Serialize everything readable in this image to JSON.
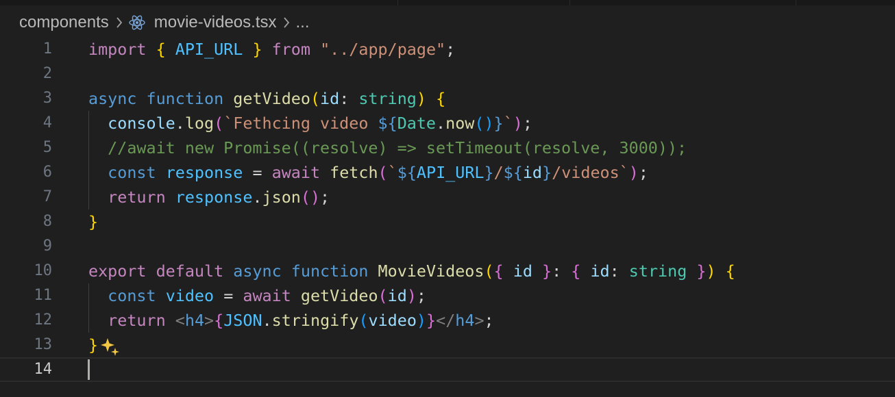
{
  "breadcrumb": {
    "folder": "components",
    "file": "movie-videos.tsx",
    "more": "..."
  },
  "colors": {
    "keyword": "#569cd6",
    "control": "#c586c0",
    "function": "#dcdcaa",
    "variable": "#9cdcfe",
    "constant": "#4fc1ff",
    "type": "#4ec9b0",
    "string": "#ce9178",
    "comment": "#6a9955",
    "tag": "#808080",
    "plain": "#d4d4d4",
    "bracket1": "#ffd700",
    "bracket2": "#da70d6",
    "bracket3": "#179fff"
  },
  "lines": [
    {
      "n": "1",
      "tokens": [
        [
          "import",
          "control"
        ],
        [
          " ",
          "plain"
        ],
        [
          "{",
          "bracket1"
        ],
        [
          " API_URL ",
          "constant"
        ],
        [
          "}",
          "bracket1"
        ],
        [
          " ",
          "plain"
        ],
        [
          "from",
          "control"
        ],
        [
          " ",
          "plain"
        ],
        [
          "\"../app/page\"",
          "string"
        ],
        [
          ";",
          "plain"
        ]
      ]
    },
    {
      "n": "2",
      "tokens": []
    },
    {
      "n": "3",
      "tokens": [
        [
          "async",
          "keyword"
        ],
        [
          " ",
          "plain"
        ],
        [
          "function",
          "keyword"
        ],
        [
          " ",
          "plain"
        ],
        [
          "getVideo",
          "function"
        ],
        [
          "(",
          "bracket1"
        ],
        [
          "id",
          "variable"
        ],
        [
          ": ",
          "plain"
        ],
        [
          "string",
          "type"
        ],
        [
          ")",
          "bracket1"
        ],
        [
          " ",
          "plain"
        ],
        [
          "{",
          "bracket1"
        ]
      ]
    },
    {
      "n": "4",
      "tokens": [
        [
          "  ",
          "plain"
        ],
        [
          "console",
          "variable"
        ],
        [
          ".",
          "plain"
        ],
        [
          "log",
          "function"
        ],
        [
          "(",
          "bracket2"
        ],
        [
          "`Fethcing video ",
          "string"
        ],
        [
          "${",
          "keyword"
        ],
        [
          "Date",
          "type"
        ],
        [
          ".",
          "plain"
        ],
        [
          "now",
          "function"
        ],
        [
          "()",
          "bracket3"
        ],
        [
          "}",
          "keyword"
        ],
        [
          "`",
          "string"
        ],
        [
          ")",
          "bracket2"
        ],
        [
          ";",
          "plain"
        ]
      ]
    },
    {
      "n": "5",
      "tokens": [
        [
          "  ",
          "plain"
        ],
        [
          "//await new Promise((resolve) => setTimeout(resolve, 3000));",
          "comment"
        ]
      ]
    },
    {
      "n": "6",
      "tokens": [
        [
          "  ",
          "plain"
        ],
        [
          "const",
          "keyword"
        ],
        [
          " ",
          "plain"
        ],
        [
          "response",
          "constant"
        ],
        [
          " = ",
          "plain"
        ],
        [
          "await",
          "control"
        ],
        [
          " ",
          "plain"
        ],
        [
          "fetch",
          "function"
        ],
        [
          "(",
          "bracket2"
        ],
        [
          "`",
          "string"
        ],
        [
          "${",
          "keyword"
        ],
        [
          "API_URL",
          "constant"
        ],
        [
          "}",
          "keyword"
        ],
        [
          "/",
          "string"
        ],
        [
          "${",
          "keyword"
        ],
        [
          "id",
          "variable"
        ],
        [
          "}",
          "keyword"
        ],
        [
          "/videos`",
          "string"
        ],
        [
          ")",
          "bracket2"
        ],
        [
          ";",
          "plain"
        ]
      ]
    },
    {
      "n": "7",
      "tokens": [
        [
          "  ",
          "plain"
        ],
        [
          "return",
          "control"
        ],
        [
          " ",
          "plain"
        ],
        [
          "response",
          "constant"
        ],
        [
          ".",
          "plain"
        ],
        [
          "json",
          "function"
        ],
        [
          "()",
          "bracket2"
        ],
        [
          ";",
          "plain"
        ]
      ]
    },
    {
      "n": "8",
      "tokens": [
        [
          "}",
          "bracket1"
        ]
      ]
    },
    {
      "n": "9",
      "tokens": []
    },
    {
      "n": "10",
      "tokens": [
        [
          "export",
          "control"
        ],
        [
          " ",
          "plain"
        ],
        [
          "default",
          "control"
        ],
        [
          " ",
          "plain"
        ],
        [
          "async",
          "keyword"
        ],
        [
          " ",
          "plain"
        ],
        [
          "function",
          "keyword"
        ],
        [
          " ",
          "plain"
        ],
        [
          "MovieVideos",
          "function"
        ],
        [
          "(",
          "bracket1"
        ],
        [
          "{",
          "bracket2"
        ],
        [
          " ",
          "plain"
        ],
        [
          "id",
          "variable"
        ],
        [
          " ",
          "plain"
        ],
        [
          "}",
          "bracket2"
        ],
        [
          ": ",
          "plain"
        ],
        [
          "{",
          "bracket2"
        ],
        [
          " ",
          "plain"
        ],
        [
          "id",
          "variable"
        ],
        [
          ": ",
          "plain"
        ],
        [
          "string",
          "type"
        ],
        [
          " ",
          "plain"
        ],
        [
          "}",
          "bracket2"
        ],
        [
          ")",
          "bracket1"
        ],
        [
          " ",
          "plain"
        ],
        [
          "{",
          "bracket1"
        ]
      ]
    },
    {
      "n": "11",
      "tokens": [
        [
          "  ",
          "plain"
        ],
        [
          "const",
          "keyword"
        ],
        [
          " ",
          "plain"
        ],
        [
          "video",
          "constant"
        ],
        [
          " = ",
          "plain"
        ],
        [
          "await",
          "control"
        ],
        [
          " ",
          "plain"
        ],
        [
          "getVideo",
          "function"
        ],
        [
          "(",
          "bracket2"
        ],
        [
          "id",
          "variable"
        ],
        [
          ")",
          "bracket2"
        ],
        [
          ";",
          "plain"
        ]
      ]
    },
    {
      "n": "12",
      "tokens": [
        [
          "  ",
          "plain"
        ],
        [
          "return",
          "control"
        ],
        [
          " ",
          "plain"
        ],
        [
          "<",
          "tag"
        ],
        [
          "h4",
          "keyword"
        ],
        [
          ">",
          "tag"
        ],
        [
          "{",
          "bracket2"
        ],
        [
          "JSON",
          "constant"
        ],
        [
          ".",
          "plain"
        ],
        [
          "stringify",
          "function"
        ],
        [
          "(",
          "bracket3"
        ],
        [
          "video",
          "variable"
        ],
        [
          ")",
          "bracket3"
        ],
        [
          "}",
          "bracket2"
        ],
        [
          "</",
          "tag"
        ],
        [
          "h4",
          "keyword"
        ],
        [
          ">",
          "tag"
        ],
        [
          ";",
          "plain"
        ]
      ]
    },
    {
      "n": "13",
      "tokens": [
        [
          "}",
          "bracket1"
        ]
      ],
      "sparkle": true
    },
    {
      "n": "14",
      "tokens": [],
      "current": true
    }
  ]
}
